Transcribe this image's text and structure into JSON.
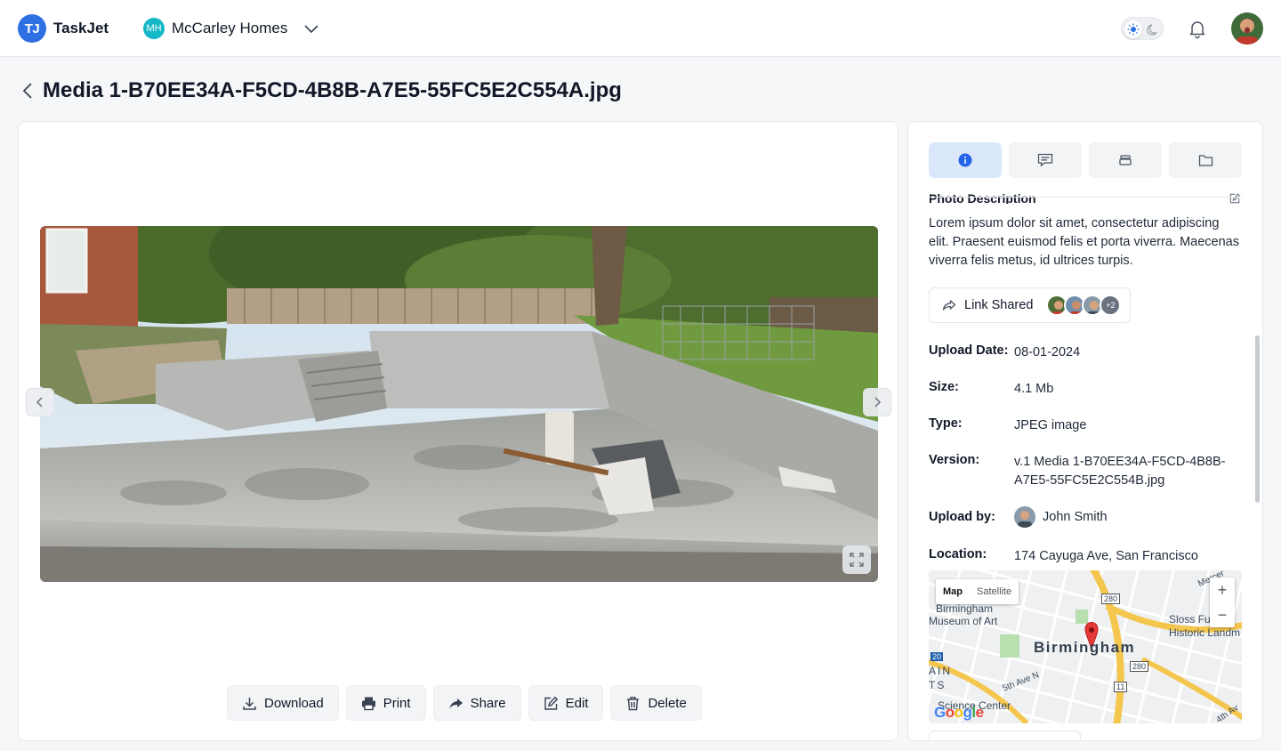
{
  "app": {
    "logo_initials": "TJ",
    "name": "TaskJet",
    "org_initials": "MH",
    "org_name": "McCarley Homes"
  },
  "header": {
    "icons": [
      "sun-icon",
      "moon-icon",
      "bell-icon",
      "user-avatar"
    ]
  },
  "page": {
    "title": "Media 1-B70EE34A-F5CD-4B8B-A7E5-55FC5E2C554A.jpg"
  },
  "viewer": {
    "actions": [
      {
        "label": "Download",
        "icon": "download-icon"
      },
      {
        "label": "Print",
        "icon": "printer-icon"
      },
      {
        "label": "Share",
        "icon": "share-icon"
      },
      {
        "label": "Edit",
        "icon": "edit-icon"
      },
      {
        "label": "Delete",
        "icon": "trash-icon"
      }
    ]
  },
  "side": {
    "tabs": [
      {
        "icon": "info-icon",
        "active": true
      },
      {
        "icon": "comment-icon",
        "active": false
      },
      {
        "icon": "layers-icon",
        "active": false
      },
      {
        "icon": "folder-icon",
        "active": false
      }
    ],
    "description_title": "Photo Description",
    "description_text": "Lorem ipsum dolor sit amet, consectetur adipiscing elit. Praesent euismod felis et porta viverra. Maecenas viverra felis metus, id ultrices turpis.",
    "link_shared_label": "Link Shared",
    "link_shared_more": "+2",
    "details": {
      "upload_date_label": "Upload Date:",
      "upload_date": "08-01-2024",
      "size_label": "Size:",
      "size": "4.1 Mb",
      "type_label": "Type:",
      "type": "JPEG image",
      "version_label": "Version:",
      "version": "v.1 Media 1-B70EE34A-F5CD-4B8B-A7E5-55FC5E2C554B.jpg",
      "upload_by_label": "Upload by:",
      "upload_by": "John Smith",
      "location_label": "Location:",
      "location": "174 Cayuga Ave, San Francisco"
    },
    "map": {
      "type_map": "Map",
      "type_satellite": "Satellite",
      "zoom_in": "+",
      "zoom_out": "−",
      "labels": {
        "museum": "Birmingham",
        "museum2": "Museum of Art",
        "city": "Birmingham",
        "sloss": "Sloss Fu",
        "sloss2": "Historic Landm",
        "science": "Science Center",
        "ave": "5th Ave N",
        "fourth": "4th Av",
        "mercer": "Mercer",
        "i20": "20",
        "r280a": "280",
        "r280b": "280",
        "r11": "11",
        "ain": "AIN",
        "ts": "TS"
      },
      "google": "Google"
    }
  },
  "colors": {
    "accent": "#2f6fe4",
    "org": "#14b8c8",
    "tab_active": "#dbe8fb"
  }
}
